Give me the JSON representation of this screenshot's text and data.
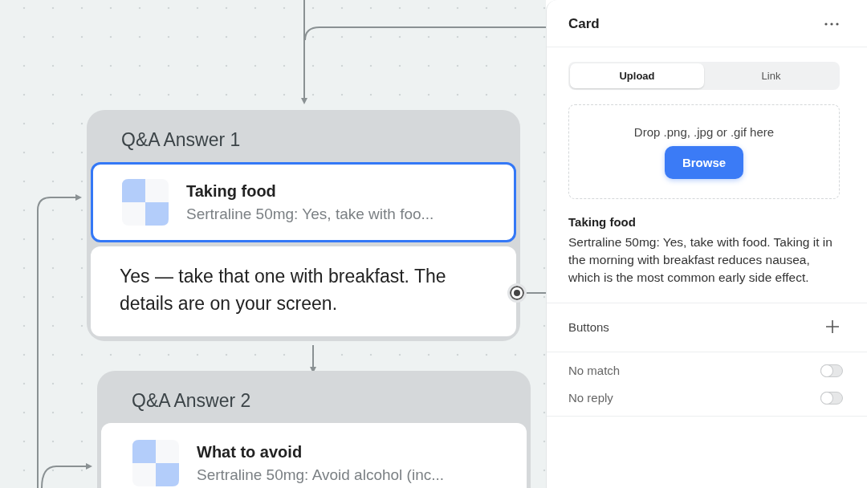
{
  "nodes": [
    {
      "title": "Q&A Answer 1",
      "card": {
        "title": "Taking food",
        "subtitle": "Sertraline 50mg: Yes, take with foo...",
        "selected": true
      },
      "message": "Yes — take that one with breakfast. The details are on your screen."
    },
    {
      "title": "Q&A Answer 2",
      "card": {
        "title": "What to avoid",
        "subtitle": "Sertraline 50mg: Avoid alcohol (inc...",
        "selected": false
      }
    }
  ],
  "panel": {
    "title": "Card",
    "tabs": [
      {
        "label": "Upload",
        "selected": true
      },
      {
        "label": "Link",
        "selected": false
      }
    ],
    "dropzone": {
      "hint": "Drop .png, .jpg or .gif here",
      "button": "Browse"
    },
    "card_title": "Taking food",
    "card_description": "Sertraline 50mg: Yes, take with food. Taking it in the morning with breakfast reduces nausea, which is the most common early side effect.",
    "buttons_label": "Buttons",
    "toggles": [
      {
        "label": "No match",
        "on": false
      },
      {
        "label": "No reply",
        "on": false
      }
    ]
  }
}
